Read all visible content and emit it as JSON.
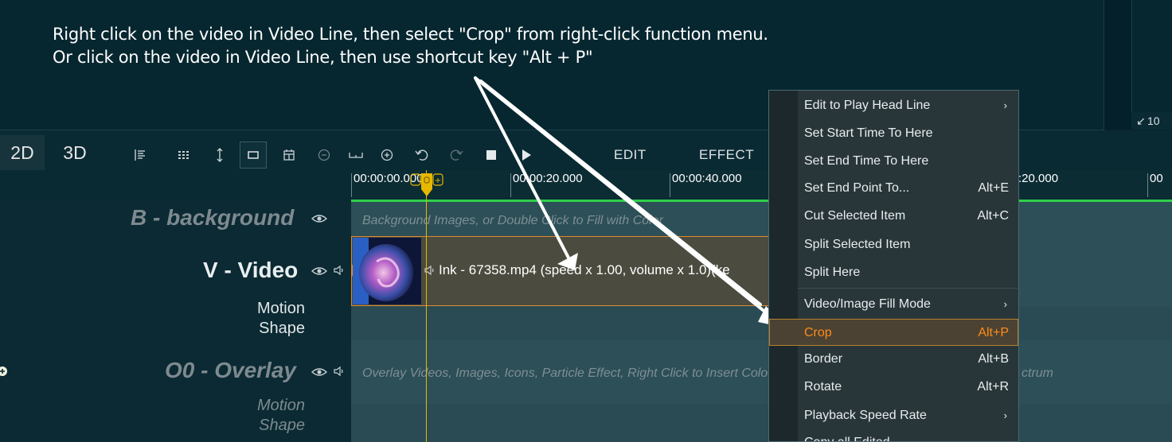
{
  "instructions": {
    "line1": "Right click on the video in Video Line, then select \"Crop\" from right-click function menu.",
    "line2": "Or click on the video in Video Line, then use shortcut key \"Alt + P\""
  },
  "zoom": {
    "value": "10"
  },
  "toolbar": {
    "tab_2d": "2D",
    "tab_3d": "3D",
    "edit_label": "EDIT",
    "effect_label": "EFFECT",
    "icons": [
      "align-left-icon",
      "grid-icon",
      "vertical-resize-icon",
      "select-box-icon",
      "calendar-icon",
      "zoom-out-icon",
      "ruler-icon",
      "zoom-in-icon",
      "undo-icon",
      "redo-icon",
      "stop-icon",
      "play-icon"
    ]
  },
  "ruler": {
    "labels": [
      "00:00:00.000",
      "00:00:20.000",
      "00:00:40.000",
      ":20.000",
      "00"
    ]
  },
  "tracks": {
    "background": {
      "name": "B - background",
      "hint": "Background Images, or Double Click to Fill with Color"
    },
    "video": {
      "name": "V - Video",
      "motion": "Motion",
      "shape": "Shape",
      "clip_label": "Ink - 67358.mp4  (speed x 1.00, volume x 1.0)(ke"
    },
    "overlay": {
      "name": "O0 - Overlay",
      "motion": "Motion",
      "shape": "Shape",
      "hint": "Overlay Videos, Images, Icons, Particle Effect, Right Click to Insert Colo",
      "hint_tail": "ctrum"
    }
  },
  "context_menu": {
    "items": [
      {
        "label": "Edit to Play Head Line",
        "shortcut": "",
        "submenu": true
      },
      {
        "label": "Set Start Time To Here",
        "shortcut": "",
        "submenu": false
      },
      {
        "label": "Set End Time To Here",
        "shortcut": "",
        "submenu": false
      },
      {
        "label": "Set End Point To...",
        "shortcut": "Alt+E",
        "submenu": false
      },
      {
        "label": "Cut Selected Item",
        "shortcut": "Alt+C",
        "submenu": false
      },
      {
        "label": "Split Selected Item",
        "shortcut": "",
        "submenu": false
      },
      {
        "label": "Split Here",
        "shortcut": "",
        "submenu": false
      },
      {
        "label": "Video/Image Fill Mode",
        "shortcut": "",
        "submenu": true
      },
      {
        "label": "Crop",
        "shortcut": "Alt+P",
        "submenu": false,
        "highlighted": true
      },
      {
        "label": "Border",
        "shortcut": "Alt+B",
        "submenu": false
      },
      {
        "label": "Rotate",
        "shortcut": "Alt+R",
        "submenu": false
      },
      {
        "label": "Playback Speed Rate",
        "shortcut": "",
        "submenu": true
      },
      {
        "label": "Copy all Edited",
        "shortcut": "",
        "submenu": false
      }
    ]
  },
  "colors": {
    "accent_orange": "#ff8c1a",
    "playhead": "#e6b800",
    "timeline_green": "#2fd04a"
  }
}
